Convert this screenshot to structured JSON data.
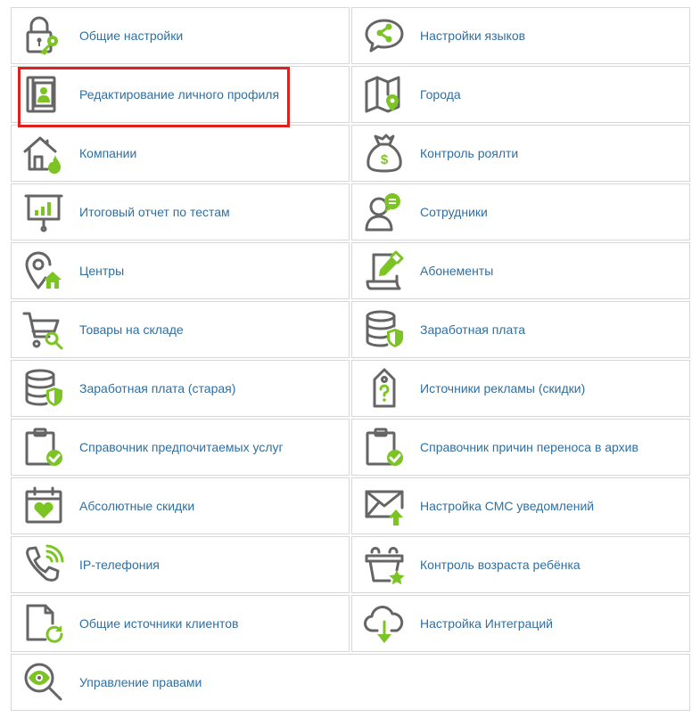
{
  "items": [
    {
      "label": "Общие настройки",
      "icon": "lock-key-icon"
    },
    {
      "label": "Настройки языков",
      "icon": "chat-share-icon"
    },
    {
      "label": "Редактирование личного профиля",
      "icon": "profile-book-icon"
    },
    {
      "label": "Города",
      "icon": "map-pin-icon"
    },
    {
      "label": "Компании",
      "icon": "house-fire-icon"
    },
    {
      "label": "Контроль роялти",
      "icon": "money-bag-icon"
    },
    {
      "label": "Итоговый отчет по тестам",
      "icon": "presentation-chart-icon"
    },
    {
      "label": "Сотрудники",
      "icon": "person-chat-icon"
    },
    {
      "label": "Центры",
      "icon": "pin-home-icon"
    },
    {
      "label": "Абонементы",
      "icon": "document-pencil-icon"
    },
    {
      "label": "Товары на складе",
      "icon": "cart-search-icon"
    },
    {
      "label": "Заработная плата",
      "icon": "database-shield-icon"
    },
    {
      "label": "Заработная плата (старая)",
      "icon": "database-shield-icon"
    },
    {
      "label": "Источники рекламы (скидки)",
      "icon": "tag-question-icon"
    },
    {
      "label": "Справочник предпочитаемых услуг",
      "icon": "clipboard-check-icon"
    },
    {
      "label": "Справочник причин переноса в архив",
      "icon": "clipboard-check-icon"
    },
    {
      "label": "Абсолютные скидки",
      "icon": "calendar-heart-icon"
    },
    {
      "label": "Настройка СМС уведомлений",
      "icon": "envelope-upload-icon"
    },
    {
      "label": "IP-телефония",
      "icon": "phone-signal-icon"
    },
    {
      "label": "Контроль возраста ребёнка",
      "icon": "basket-star-icon"
    },
    {
      "label": "Общие источники клиентов",
      "icon": "file-refresh-icon"
    },
    {
      "label": "Настройка Интеграций",
      "icon": "cloud-download-icon"
    },
    {
      "label": "Управление правами",
      "icon": "eye-magnifier-icon"
    }
  ],
  "colors": {
    "accent": "#7cc324",
    "icon": "#656565",
    "link": "#2f6fa1",
    "highlight": "#e0201d"
  }
}
